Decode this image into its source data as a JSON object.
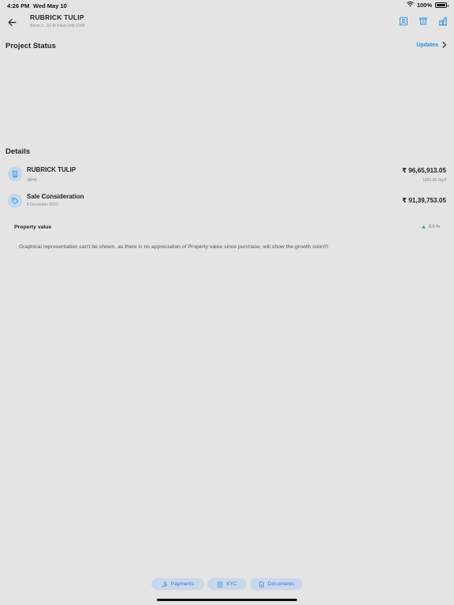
{
  "status_bar": {
    "time": "4:26 PM",
    "date": "Wed May 10",
    "battery": "100%"
  },
  "header": {
    "title": "RUBRICK TULIP",
    "subtitle": "Block 2 , 10 th Floor,Unit 1009",
    "icons": [
      "contact-card-icon",
      "receipt-icon",
      "building-analytics-icon"
    ]
  },
  "project_status": {
    "title": "Project Status",
    "updates_label": "Updates"
  },
  "details": {
    "title": "Details",
    "items": [
      {
        "icon": "building-icon",
        "name": "RUBRICK TULIP",
        "sub": "3BHK",
        "amount": "₹ 96,65,913.05",
        "right_sub": "1865.00 Sq.ft"
      },
      {
        "icon": "tag-icon",
        "name": "Sale Consideration",
        "sub": "8 December 2023",
        "amount": "₹ 91,39,753.05",
        "right_sub": ""
      }
    ]
  },
  "property_value": {
    "label": "Property value",
    "change": "0.0 %",
    "message": "Graphical representation can't be shown, as there is no appreciation of Property value since purchase, will show the growth soon!!!"
  },
  "bottom_tabs": [
    {
      "label": "Payments",
      "icon": "payments-icon"
    },
    {
      "label": "KYC",
      "icon": "kyc-icon"
    },
    {
      "label": "Documents",
      "icon": "documents-icon"
    }
  ],
  "colors": {
    "background": "#e4e4e4",
    "accent": "#2b8de4",
    "icon_bg": "#c2d6ec",
    "tab_bg": "#c8d8ea",
    "positive": "#2eae6a"
  }
}
